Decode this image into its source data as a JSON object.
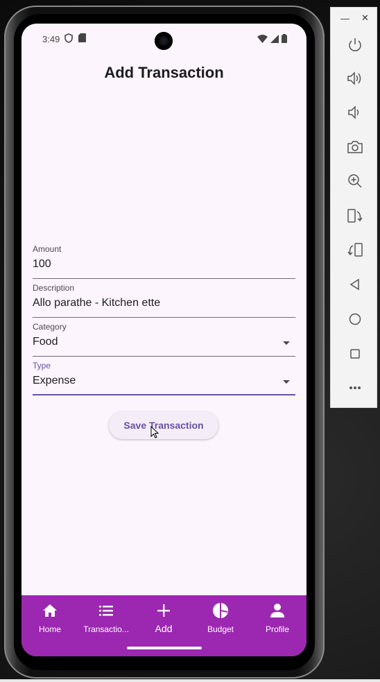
{
  "status_bar": {
    "time": "3:49"
  },
  "screen": {
    "title": "Add Transaction"
  },
  "form": {
    "amount": {
      "label": "Amount",
      "value": "100"
    },
    "description": {
      "label": "Description",
      "value": "Allo parathe - Kitchen ette"
    },
    "category": {
      "label": "Category",
      "value": "Food"
    },
    "type": {
      "label": "Type",
      "value": "Expense"
    }
  },
  "save_button_label": "Save Transaction",
  "nav": {
    "items": [
      {
        "label": "Home",
        "icon": "home-icon"
      },
      {
        "label": "Transactio...",
        "icon": "list-icon"
      },
      {
        "label": "Add",
        "icon": "add-icon"
      },
      {
        "label": "Budget",
        "icon": "pie-chart-icon"
      },
      {
        "label": "Profile",
        "icon": "person-icon"
      }
    ],
    "active": "Add"
  },
  "colors": {
    "nav_bar": "#9c27b0",
    "accent": "#6750a4",
    "background": "#fdf5fd"
  },
  "emulator_toolbar": {
    "buttons": [
      "power-icon",
      "volume-up-icon",
      "volume-down-icon",
      "camera-icon",
      "zoom-in-icon",
      "rotate-left-icon",
      "rotate-right-icon",
      "back-icon",
      "home-icon",
      "overview-icon",
      "more-icon"
    ]
  }
}
